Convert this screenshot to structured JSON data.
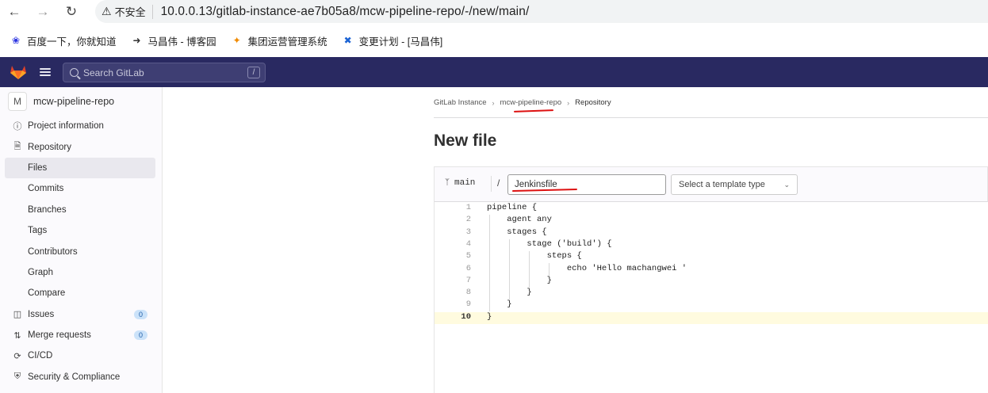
{
  "browser": {
    "insecure_label": "不安全",
    "url": "10.0.0.13/gitlab-instance-ae7b05a8/mcw-pipeline-repo/-/new/main/",
    "bookmarks": [
      {
        "label": "百度一下，你就知道"
      },
      {
        "label": "马昌伟 - 博客园"
      },
      {
        "label": "集团运营管理系统"
      },
      {
        "label": "变更计划 - [马昌伟]"
      }
    ]
  },
  "topbar": {
    "search_placeholder": "Search GitLab",
    "search_shortcut": "/"
  },
  "sidebar": {
    "project_avatar": "M",
    "project_name": "mcw-pipeline-repo",
    "items": [
      {
        "label": "Project information"
      },
      {
        "label": "Repository"
      },
      {
        "label": "Files"
      },
      {
        "label": "Commits"
      },
      {
        "label": "Branches"
      },
      {
        "label": "Tags"
      },
      {
        "label": "Contributors"
      },
      {
        "label": "Graph"
      },
      {
        "label": "Compare"
      },
      {
        "label": "Issues",
        "badge": "0"
      },
      {
        "label": "Merge requests",
        "badge": "0"
      },
      {
        "label": "CI/CD"
      },
      {
        "label": "Security & Compliance"
      }
    ]
  },
  "breadcrumb": [
    "GitLab Instance",
    "mcw-pipeline-repo",
    "Repository"
  ],
  "page_title": "New file",
  "editor": {
    "branch": "main",
    "path_sep": "/",
    "file_name": "Jenkinsfile",
    "template_select": "Select a template type",
    "lines": [
      {
        "n": "1",
        "text": "pipeline {"
      },
      {
        "n": "2",
        "text": "    agent any"
      },
      {
        "n": "3",
        "text": "    stages {"
      },
      {
        "n": "4",
        "text": "        stage ('build') {"
      },
      {
        "n": "5",
        "text": "            steps {"
      },
      {
        "n": "6",
        "text": "                echo 'Hello machangwei '"
      },
      {
        "n": "7",
        "text": "            }"
      },
      {
        "n": "8",
        "text": "        }"
      },
      {
        "n": "9",
        "text": "    }"
      },
      {
        "n": "10",
        "text": "}"
      }
    ]
  }
}
